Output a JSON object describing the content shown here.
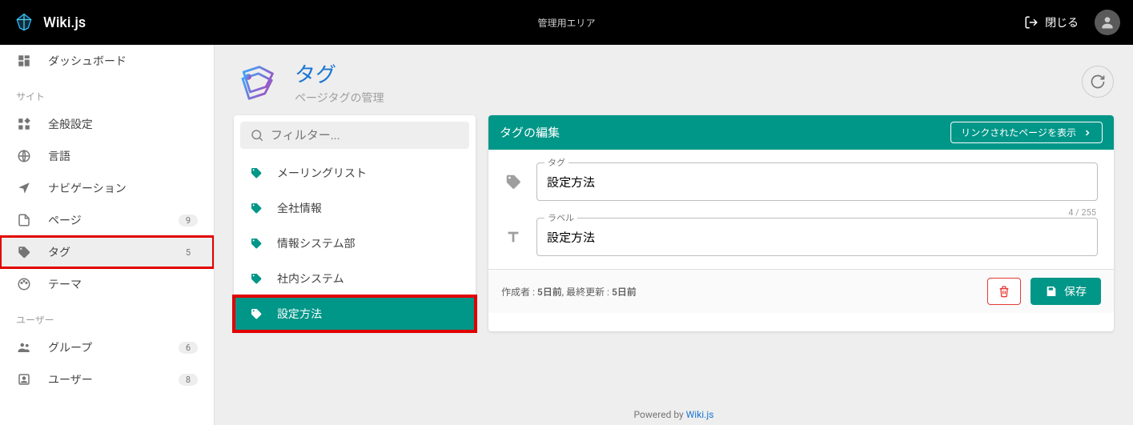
{
  "header": {
    "app_title": "Wiki.js",
    "center_text": "管理用エリア",
    "close_label": "閉じる"
  },
  "sidebar": {
    "dashboard": "ダッシュボード",
    "section_site": "サイト",
    "general": "全般設定",
    "locale": "言語",
    "navigation": "ナビゲーション",
    "pages": {
      "label": "ページ",
      "badge": "9"
    },
    "tags": {
      "label": "タグ",
      "badge": "5"
    },
    "theme": "テーマ",
    "section_users": "ユーザー",
    "groups": {
      "label": "グループ",
      "badge": "6"
    },
    "users": {
      "label": "ユーザー",
      "badge": "8"
    }
  },
  "page": {
    "title": "タグ",
    "subtitle": "ページタグの管理"
  },
  "filter": {
    "placeholder": "フィルター..."
  },
  "tag_list": [
    {
      "label": "メーリングリスト"
    },
    {
      "label": "全社情報"
    },
    {
      "label": "情報システム部"
    },
    {
      "label": "社内システム"
    },
    {
      "label": "設定方法"
    }
  ],
  "editor": {
    "header_title": "タグの編集",
    "linked_pages_label": "リンクされたページを表示",
    "field_tag_label": "タグ",
    "field_tag_value": "設定方法",
    "char_count": "4 / 255",
    "field_label_label": "ラベル",
    "field_label_value": "設定方法",
    "meta_prefix": "作成者 : ",
    "meta_created": "5日前",
    "meta_sep": ", 最終更新 : ",
    "meta_updated": "5日前",
    "save_label": "保存"
  },
  "footer": {
    "prefix": "Powered by ",
    "link": "Wiki.js"
  }
}
